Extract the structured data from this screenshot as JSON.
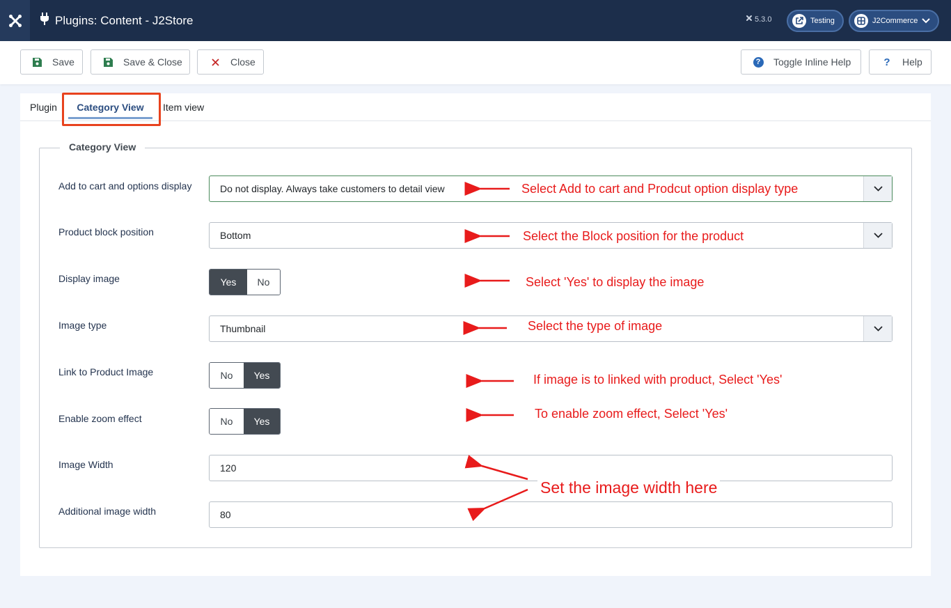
{
  "header": {
    "title": "Plugins: Content - J2Store",
    "version": "5.3.0",
    "site_link": "Testing",
    "user_menu": "J2Commerce"
  },
  "toolbar": {
    "save": "Save",
    "save_close": "Save & Close",
    "close": "Close",
    "toggle_help": "Toggle Inline Help",
    "help": "Help"
  },
  "tabs": [
    {
      "label": "Plugin"
    },
    {
      "label": "Category View"
    },
    {
      "label": "Item view"
    }
  ],
  "fieldset": {
    "legend": "Category View",
    "fields": {
      "add_to_cart": {
        "label": "Add to cart and options display",
        "value": "Do not display. Always take customers to detail view"
      },
      "block_position": {
        "label": "Product block position",
        "value": "Bottom"
      },
      "display_image": {
        "label": "Display image",
        "options": [
          "Yes",
          "No"
        ],
        "selected": "Yes"
      },
      "image_type": {
        "label": "Image type",
        "value": "Thumbnail"
      },
      "link_image": {
        "label": "Link to Product Image",
        "options": [
          "No",
          "Yes"
        ],
        "selected": "Yes"
      },
      "zoom": {
        "label": "Enable zoom effect",
        "options": [
          "No",
          "Yes"
        ],
        "selected": "Yes"
      },
      "image_width": {
        "label": "Image Width",
        "value": "120"
      },
      "additional_width": {
        "label": "Additional image width",
        "value": "80"
      }
    }
  },
  "annotations": {
    "add_to_cart": "Select Add to cart and Prodcut option display type",
    "block_position": "Select the Block position for the product",
    "display_image": "Select 'Yes' to display the image",
    "image_type": "Select the type of image",
    "link_image": "If image is to linked with product, Select 'Yes'",
    "zoom": "To enable zoom effect, Select 'Yes'",
    "width": "Set the image width here",
    "color": "#e81b1b"
  }
}
